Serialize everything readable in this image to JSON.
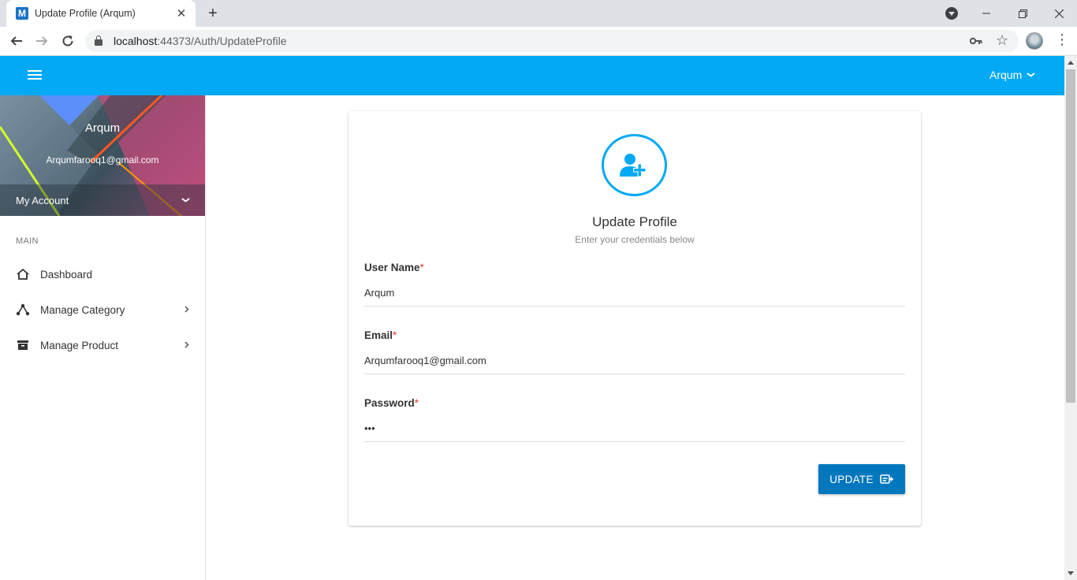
{
  "browser": {
    "tab_title": "Update Profile (Arqum)",
    "favicon_letter": "M",
    "url_host": "localhost",
    "url_rest": ":44373/Auth/UpdateProfile"
  },
  "header": {
    "user_name": "Arqum"
  },
  "sidebar": {
    "profile_name": "Arqum",
    "profile_email": "Arqumfarooq1@gmail.com",
    "account_label": "My Account",
    "section_label": "MAIN",
    "items": [
      {
        "label": "Dashboard",
        "icon": "home-icon"
      },
      {
        "label": "Manage Category",
        "icon": "category-icon"
      },
      {
        "label": "Manage Product",
        "icon": "archive-icon"
      }
    ]
  },
  "form": {
    "title": "Update Profile",
    "subtitle": "Enter your credentials below",
    "username_label": "User Name",
    "username_value": "Arqum",
    "email_label": "Email",
    "email_value": "Arqumfarooq1@gmail.com",
    "password_label": "Password",
    "password_value": "•••",
    "required_mark": "*",
    "update_label": "UPDATE"
  },
  "colors": {
    "appbar": "#03a9f4",
    "button": "#0277bd",
    "required": "#e53935"
  }
}
